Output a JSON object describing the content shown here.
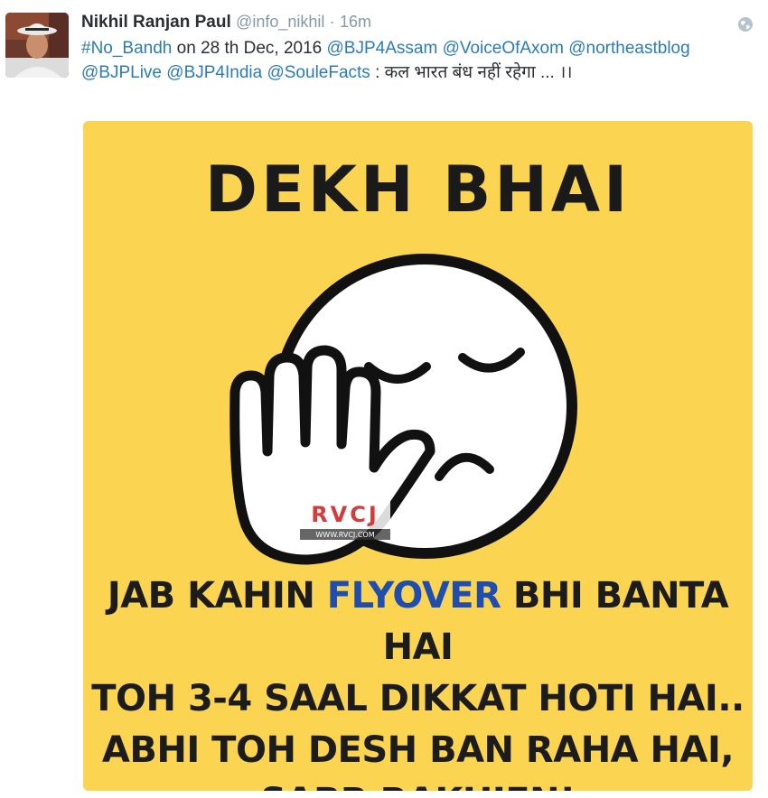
{
  "tweet": {
    "author_name": "Nikhil Ranjan Paul",
    "handle": "@info_nikhil",
    "separator": "·",
    "time": "16m",
    "text": {
      "hashtag": "#No_Bandh",
      "date_text": " on 28 th Dec, 2016 ",
      "mention_1": "@BJP4Assam",
      "mention_2": "@VoiceOfAxom",
      "mention_3": "@northeastblog",
      "mention_4": "@BJPLive",
      "mention_5": "@BJP4India",
      "mention_6": "@SouleFacts",
      "hindi_text": " : कल भारत बंध नहीं रहेगा ... ।।"
    },
    "globe_icon": "globe-icon"
  },
  "meme": {
    "background_color": "#fbd451",
    "title": "DEKH BHAI",
    "watermark": "RVCJ",
    "watermark_url": "WWW.RVCJ.COM",
    "caption": {
      "line1_a": "JAB KAHIN ",
      "line1_highlight": "FLYOVER",
      "line1_b": " BHI BANTA HAI",
      "line2": "TOH 3-4 SAAL DIKKAT HOTI HAI..",
      "line3": "ABHI TOH DESH BAN RAHA HAI,",
      "line4": "SABR RAKHIEN!"
    },
    "highlight_color": "#1f4eb0",
    "emoji_icon": "facepalm-emoji-icon"
  }
}
